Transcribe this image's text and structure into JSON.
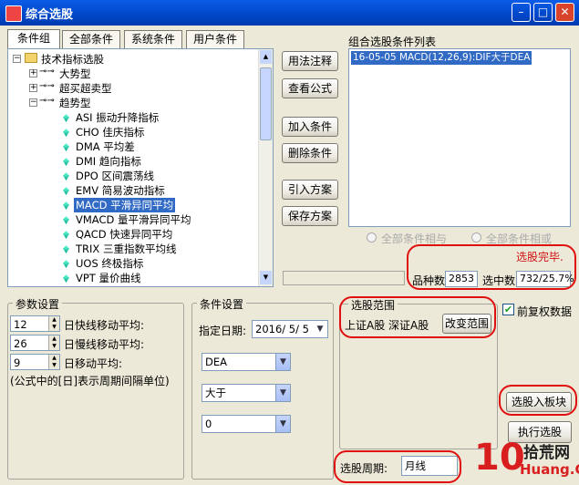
{
  "window": {
    "title": "综合选股",
    "min": "–",
    "max": "□",
    "close": "✕"
  },
  "tabs": [
    {
      "label": "条件组"
    },
    {
      "label": "全部条件"
    },
    {
      "label": "系统条件"
    },
    {
      "label": "用户条件"
    }
  ],
  "tree": {
    "root": "技术指标选股",
    "groups": [
      "大势型",
      "超买超卖型",
      "趋势型"
    ],
    "items": [
      "ASI 振动升降指标",
      "CHO 佳庆指标",
      "DMA 平均差",
      "DMI 趋向指标",
      "DPO 区间震荡线",
      "EMV 简易波动指标",
      "MACD 平滑异同平均",
      "VMACD 量平滑异同平均",
      "QACD 快速异同平均",
      "TRIX 三重指数平均线",
      "UOS 终极指标",
      "VPT 量价曲线"
    ],
    "selected_index": 6
  },
  "middle_buttons": {
    "usage": "用法注释",
    "view_formula": "查看公式",
    "add": "加入条件",
    "delete": "删除条件",
    "import": "引入方案",
    "save": "保存方案"
  },
  "condition_list": {
    "title": "组合选股条件列表",
    "items": [
      "16-05-05 MACD(12,26,9):DIF大于DEA"
    ]
  },
  "logic": {
    "all_and": "全部条件相与",
    "all_or": "全部条件相或"
  },
  "status": {
    "done": "选股完毕.",
    "count_label": "品种数",
    "count_value": "2853",
    "selected_label": "选中数",
    "selected_value": "732/25.7%"
  },
  "params": {
    "title": "参数设置",
    "rows": [
      {
        "value": "12",
        "label": "日快线移动平均:"
      },
      {
        "value": "26",
        "label": "日慢线移动平均:"
      },
      {
        "value": "9",
        "label": "日移动平均:"
      }
    ],
    "note": "(公式中的[日]表示周期间隔单位)"
  },
  "cond_settings": {
    "title": "条件设置",
    "date_label": "指定日期:",
    "date_value": "2016/ 5/ 5",
    "line_value": "DEA",
    "op_value": "大于",
    "num_value": "0"
  },
  "range": {
    "title": "选股范围",
    "value": "上证A股 深证A股",
    "change_button": "改变范围"
  },
  "right": {
    "restore_label": "前复权数据",
    "to_board": "选股入板块",
    "execute": "执行选股"
  },
  "period": {
    "label": "选股周期:",
    "value": "月线"
  },
  "watermark": {
    "num": "10",
    "text": "拾荒网",
    "url": "Huang.CN"
  }
}
